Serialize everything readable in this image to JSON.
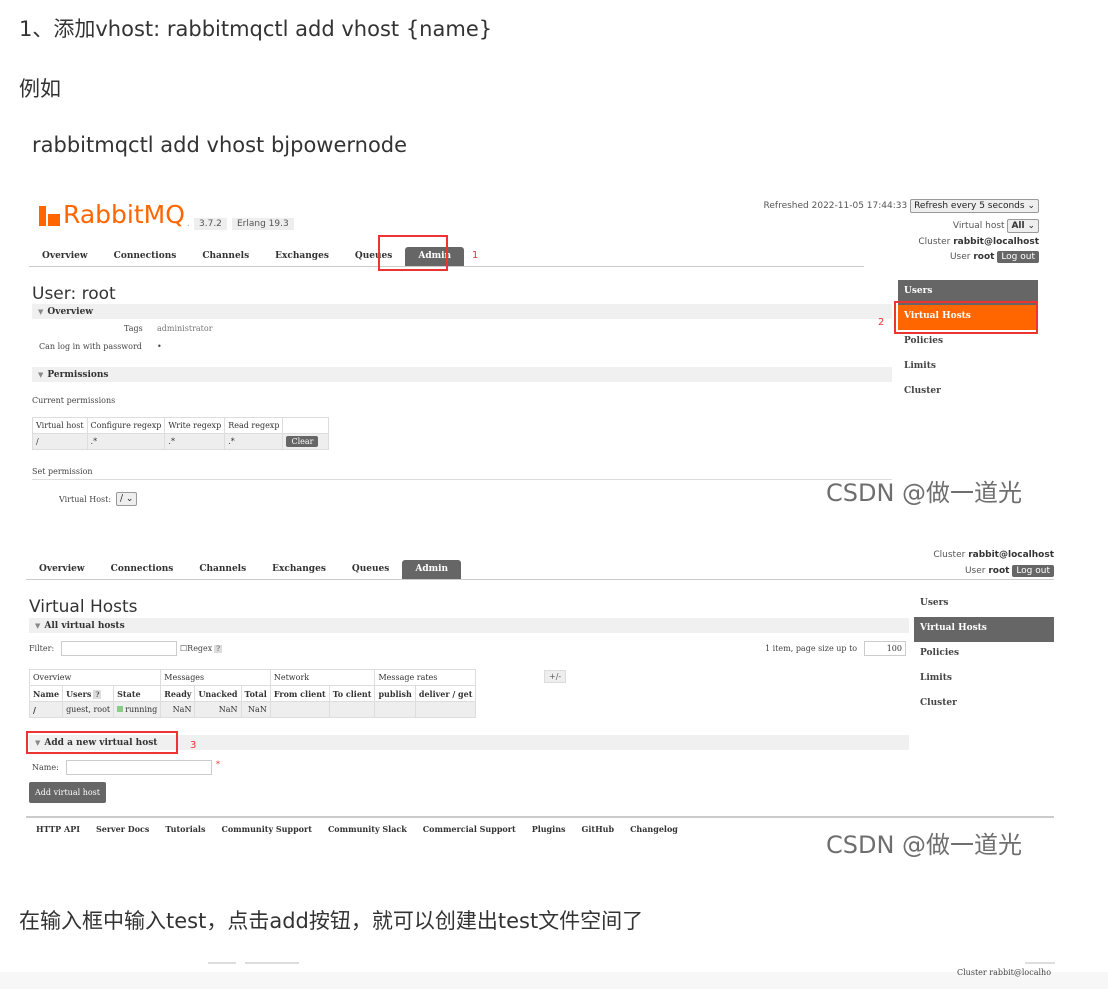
{
  "article": {
    "line1": "1、添加vhost: rabbitmqctl add vhost {name}",
    "line2": "例如",
    "line3": "rabbitmqctl add vhost bjpowernode",
    "line4": "在输入框中输入test，点击add按钮，就可以创建出test文件空间了"
  },
  "screenshot1": {
    "logo_text": "RabbitMQ",
    "logo_tm": ".",
    "version": "3.7.2",
    "erlang": "Erlang 19.3",
    "refreshed": "Refreshed 2022-11-05 17:44:33",
    "refresh_select": "Refresh every 5 seconds",
    "vhost_label": "Virtual host",
    "vhost_value": "All",
    "cluster_label": "Cluster",
    "cluster_value": "rabbit@localhost",
    "user_label": "User",
    "user_value": "root",
    "logout": "Log out",
    "tabs": [
      "Overview",
      "Connections",
      "Channels",
      "Exchanges",
      "Queues",
      "Admin"
    ],
    "annot1": "1",
    "annot2": "2",
    "title_prefix": "User:",
    "title_user": "root",
    "overview_head": "Overview",
    "tags_label": "Tags",
    "tags_value": "administrator",
    "canlogin_label": "Can log in with password",
    "canlogin_value": "•",
    "permissions_head": "Permissions",
    "current_permissions": "Current permissions",
    "perm_headers": [
      "Virtual host",
      "Configure regexp",
      "Write regexp",
      "Read regexp"
    ],
    "perm_row": [
      "/",
      ".*",
      ".*",
      ".*"
    ],
    "clear": "Clear",
    "set_permission": "Set permission",
    "vhost_field_label": "Virtual Host:",
    "vhost_field_value": "/",
    "sidebar": [
      "Users",
      "Virtual Hosts",
      "Policies",
      "Limits",
      "Cluster"
    ],
    "watermark": "CSDN @做一道光"
  },
  "screenshot2": {
    "cluster_label": "Cluster",
    "cluster_value": "rabbit@localhost",
    "user_label": "User",
    "user_value": "root",
    "logout": "Log out",
    "tabs": [
      "Overview",
      "Connections",
      "Channels",
      "Exchanges",
      "Queues",
      "Admin"
    ],
    "title": "Virtual Hosts",
    "all_vhosts_head": "All virtual hosts",
    "filter_label": "Filter:",
    "regex_label": "Regex",
    "regex_q": "?",
    "page_size_label": "1 item, page size up to",
    "page_size_value": "100",
    "group_headers": [
      "Overview",
      "Messages",
      "Network",
      "Message rates"
    ],
    "plusminus": "+/-",
    "col_headers": [
      "Name",
      "Users",
      "State",
      "Ready",
      "Unacked",
      "Total",
      "From client",
      "To client",
      "publish",
      "deliver / get"
    ],
    "row": {
      "name": "/",
      "users": "guest, root",
      "state": "running",
      "ready": "NaN",
      "unacked": "NaN",
      "total": "NaN"
    },
    "add_head": "Add a new virtual host",
    "annot3": "3",
    "name_label": "Name:",
    "required_mark": "*",
    "add_button": "Add virtual host",
    "sidebar": [
      "Users",
      "Virtual Hosts",
      "Policies",
      "Limits",
      "Cluster"
    ],
    "footer": [
      "HTTP API",
      "Server Docs",
      "Tutorials",
      "Community Support",
      "Community Slack",
      "Commercial Support",
      "Plugins",
      "GitHub",
      "Changelog"
    ],
    "watermark": "CSDN @做一道光"
  },
  "screenshot3": {
    "cluster_text": "Cluster rabbit@localho"
  }
}
